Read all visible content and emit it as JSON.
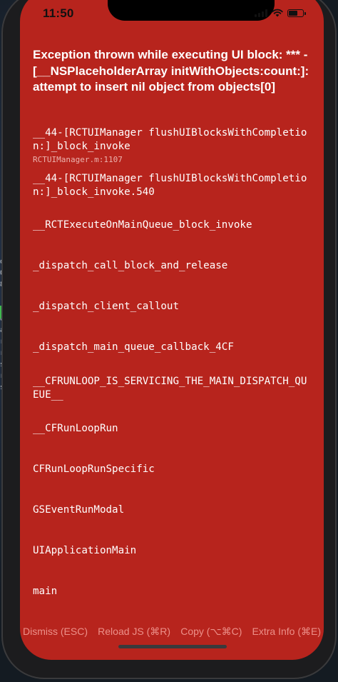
{
  "status_bar": {
    "time": "11:50"
  },
  "backdrop": {
    "letters": [
      "d",
      "0",
      "8",
      "",
      "",
      "d",
      "a",
      "r",
      "r",
      "s",
      "r",
      "s"
    ]
  },
  "error": {
    "title": "Exception thrown while executing UI block: *** -[__NSPlaceholderArray initWithObjects:count:]: attempt to insert nil object from objects[0]"
  },
  "stack": [
    {
      "name": "__44-[RCTUIManager flushUIBlocksWithCompletion:]_block_invoke",
      "file": "RCTUIManager.m:1107"
    },
    {
      "name": "__44-[RCTUIManager flushUIBlocksWithCompletion:]_block_invoke.540",
      "file": ""
    },
    {
      "name": "__RCTExecuteOnMainQueue_block_invoke",
      "file": ""
    },
    {
      "name": "_dispatch_call_block_and_release",
      "file": ""
    },
    {
      "name": "_dispatch_client_callout",
      "file": ""
    },
    {
      "name": "_dispatch_main_queue_callback_4CF",
      "file": ""
    },
    {
      "name": "__CFRUNLOOP_IS_SERVICING_THE_MAIN_DISPATCH_QUEUE__",
      "file": ""
    },
    {
      "name": "__CFRunLoopRun",
      "file": ""
    },
    {
      "name": "CFRunLoopRunSpecific",
      "file": ""
    },
    {
      "name": "GSEventRunModal",
      "file": ""
    },
    {
      "name": "UIApplicationMain",
      "file": ""
    },
    {
      "name": "main",
      "file": ""
    }
  ],
  "actions": {
    "dismiss": "Dismiss (ESC)",
    "reload": "Reload JS (⌘R)",
    "copy": "Copy (⌥⌘C)",
    "extra": "Extra Info (⌘E)"
  },
  "colors": {
    "redbox_background": "#b7241d",
    "action_text": "#ec9089",
    "file_text": "#ecb3ae"
  },
  "icons": [
    "cellular-signal-icon",
    "wifi-icon",
    "battery-icon"
  ],
  "battery_level": 0.55
}
